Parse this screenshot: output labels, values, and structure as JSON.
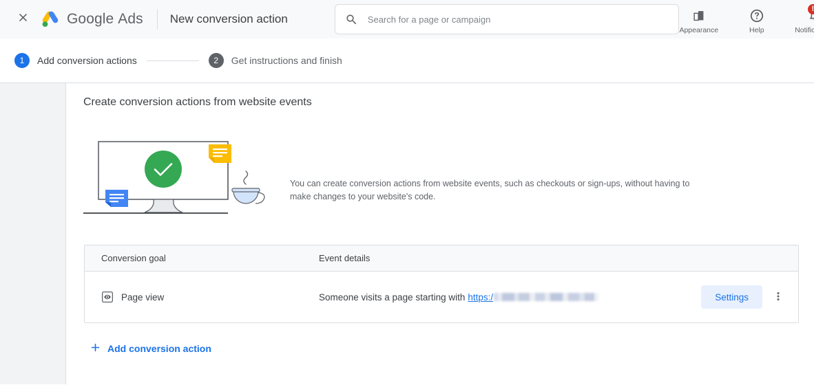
{
  "topbar": {
    "close_icon": "close-icon",
    "brand_google": "Google",
    "brand_ads": "Ads",
    "page_title": "New conversion action",
    "search": {
      "icon": "search-icon",
      "placeholder": "Search for a page or campaign",
      "value": ""
    },
    "actions": [
      {
        "icon": "appearance-icon",
        "label": "Appearance",
        "badge": ""
      },
      {
        "icon": "help-icon",
        "label": "Help",
        "badge": ""
      },
      {
        "icon": "notifications-bell-icon",
        "label": "Notifications",
        "badge": "!"
      }
    ]
  },
  "stepper": {
    "steps": [
      {
        "number": "1",
        "label": "Add conversion actions",
        "state": "active"
      },
      {
        "number": "2",
        "label": "Get instructions and finish",
        "state": "inactive"
      }
    ]
  },
  "main": {
    "section_title": "Create conversion actions from website events",
    "hero_description": "You can create conversion actions from website events, such as checkouts or sign-ups, without having to make changes to your website's code.",
    "illustration_name": "monitor-checkmark-illustration",
    "table": {
      "columns": [
        "Conversion goal",
        "Event details"
      ],
      "rows": [
        {
          "goal_icon": "page-view-eye-icon",
          "goal": "Page view",
          "event_prefix": "Someone visits a page starting with",
          "event_link": "https:/",
          "event_redacted": true,
          "settings_label": "Settings",
          "more_icon": "more-vert-icon"
        }
      ]
    },
    "add_action_link": {
      "icon": "plus-icon",
      "label": "Add conversion action"
    }
  },
  "colors": {
    "accent_blue": "#1a73e8",
    "chip_blue_bg": "#e8f0fe",
    "success_green": "#34a853",
    "badge_red": "#d93025",
    "logo_yellow": "#fbbc04",
    "logo_blue": "#4285f4",
    "logo_green": "#34a853",
    "gutter_gray": "#f1f3f4",
    "header_gray": "#f8f9fa",
    "border_gray": "#dadce0",
    "text_primary": "#3c4043",
    "text_secondary": "#5f6368"
  }
}
